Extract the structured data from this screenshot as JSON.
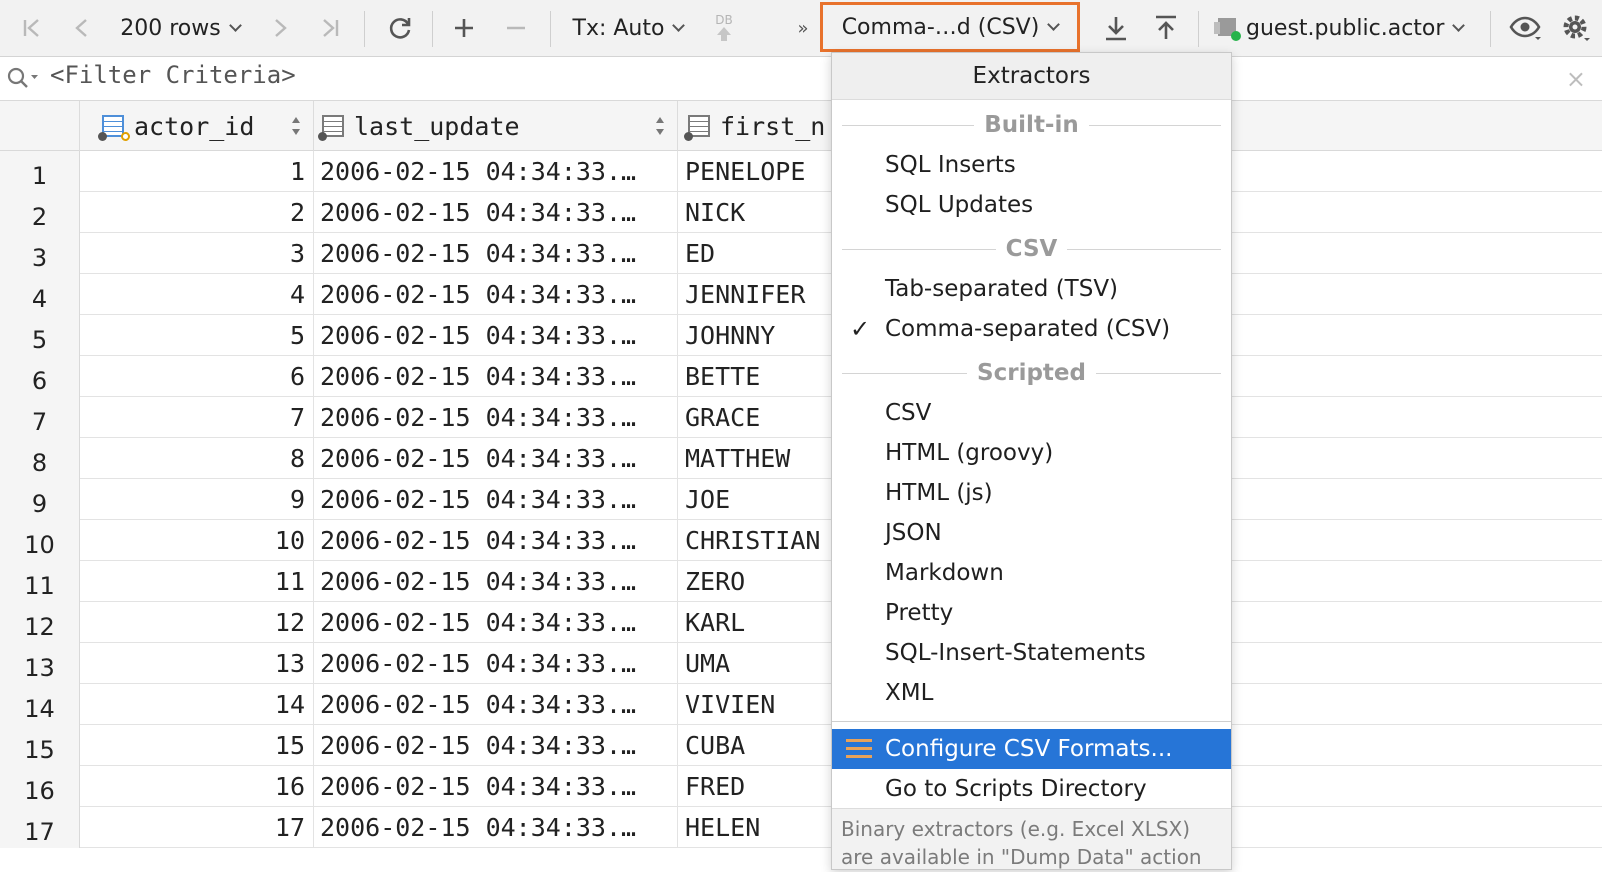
{
  "toolbar": {
    "rows_label": "200 rows",
    "tx_label": "Tx: Auto",
    "db_label": "DB",
    "more_label": "»",
    "extractor_label": "Comma-…d (CSV)",
    "datasource_label": "guest.public.actor"
  },
  "filter": {
    "placeholder": "<Filter Criteria>"
  },
  "grid": {
    "columns": [
      "actor_id",
      "last_update",
      "first_n"
    ],
    "rows": [
      {
        "n": "1",
        "id": "1",
        "lu": "2006-02-15 04:34:33.…",
        "fn": "PENELOPE"
      },
      {
        "n": "2",
        "id": "2",
        "lu": "2006-02-15 04:34:33.…",
        "fn": "NICK"
      },
      {
        "n": "3",
        "id": "3",
        "lu": "2006-02-15 04:34:33.…",
        "fn": "ED"
      },
      {
        "n": "4",
        "id": "4",
        "lu": "2006-02-15 04:34:33.…",
        "fn": "JENNIFER"
      },
      {
        "n": "5",
        "id": "5",
        "lu": "2006-02-15 04:34:33.…",
        "fn": "JOHNNY"
      },
      {
        "n": "6",
        "id": "6",
        "lu": "2006-02-15 04:34:33.…",
        "fn": "BETTE"
      },
      {
        "n": "7",
        "id": "7",
        "lu": "2006-02-15 04:34:33.…",
        "fn": "GRACE"
      },
      {
        "n": "8",
        "id": "8",
        "lu": "2006-02-15 04:34:33.…",
        "fn": "MATTHEW"
      },
      {
        "n": "9",
        "id": "9",
        "lu": "2006-02-15 04:34:33.…",
        "fn": "JOE"
      },
      {
        "n": "10",
        "id": "10",
        "lu": "2006-02-15 04:34:33.…",
        "fn": "CHRISTIAN"
      },
      {
        "n": "11",
        "id": "11",
        "lu": "2006-02-15 04:34:33.…",
        "fn": "ZERO"
      },
      {
        "n": "12",
        "id": "12",
        "lu": "2006-02-15 04:34:33.…",
        "fn": "KARL"
      },
      {
        "n": "13",
        "id": "13",
        "lu": "2006-02-15 04:34:33.…",
        "fn": "UMA"
      },
      {
        "n": "14",
        "id": "14",
        "lu": "2006-02-15 04:34:33.…",
        "fn": "VIVIEN"
      },
      {
        "n": "15",
        "id": "15",
        "lu": "2006-02-15 04:34:33.…",
        "fn": "CUBA"
      },
      {
        "n": "16",
        "id": "16",
        "lu": "2006-02-15 04:34:33.…",
        "fn": "FRED"
      },
      {
        "n": "17",
        "id": "17",
        "lu": "2006-02-15 04:34:33.…",
        "fn": "HELEN"
      }
    ]
  },
  "menu": {
    "title": "Extractors",
    "group_builtin": "Built-in",
    "sql_inserts": "SQL Inserts",
    "sql_updates": "SQL Updates",
    "group_csv": "CSV",
    "tsv": "Tab-separated (TSV)",
    "csv_comma": "Comma-separated (CSV)",
    "group_scripted": "Scripted",
    "scripted_csv": "CSV",
    "html_groovy": "HTML (groovy)",
    "html_js": "HTML (js)",
    "json": "JSON",
    "markdown": "Markdown",
    "pretty": "Pretty",
    "sql_insert_statements": "SQL-Insert-Statements",
    "xml": "XML",
    "configure": "Configure CSV Formats...",
    "go_scripts": "Go to Scripts Directory",
    "footer_line1": "Binary extractors (e.g. Excel XLSX)",
    "footer_line2": "are available in \"Dump Data\" action"
  }
}
